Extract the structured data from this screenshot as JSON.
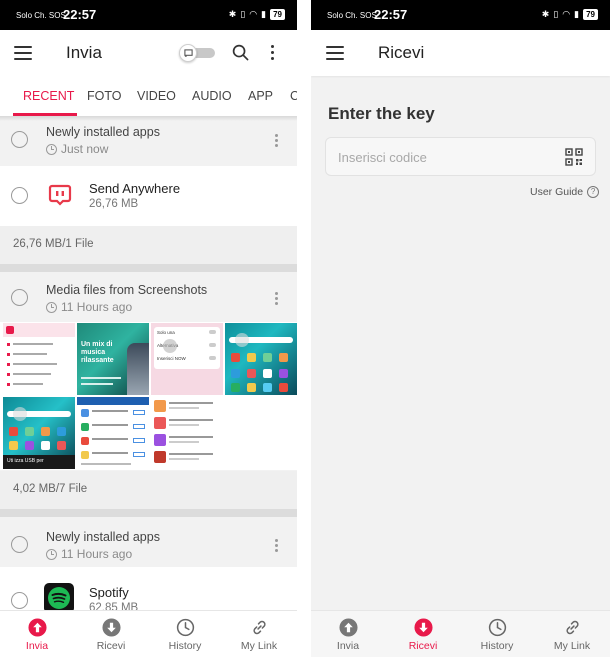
{
  "status_bar": {
    "carrier": "Solo Ch. SOS",
    "time": "22:57",
    "battery": "79"
  },
  "send_screen": {
    "title": "Invia",
    "tabs": [
      {
        "label": "RECENT",
        "active": true
      },
      {
        "label": "FOTO",
        "active": false
      },
      {
        "label": "VIDEO",
        "active": false
      },
      {
        "label": "AUDIO",
        "active": false
      },
      {
        "label": "APP",
        "active": false
      },
      {
        "label": "C",
        "active": false
      }
    ],
    "groups": [
      {
        "title": "Newly installed apps",
        "time": "Just now",
        "items": [
          {
            "name": "Send Anywhere",
            "size": "26,76 MB",
            "icon": "send-anywhere-icon"
          }
        ],
        "summary": "26,76 MB/1 File"
      },
      {
        "title": "Media files from Screenshots",
        "time": "11 Hours ago",
        "summary": "4,02 MB/7 File",
        "thumbnail_texts": {
          "t2_big": "Un mix di musica rilassante",
          "t3_row1": "Solo una",
          "t3_row2": "Alternativa",
          "t3_row3": "Inserisci NOW",
          "t5_label": "Uti izza USB per"
        }
      },
      {
        "title": "Newly installed apps",
        "time": "11 Hours ago",
        "items": [
          {
            "name": "Spotify",
            "size": "62,85 MB",
            "icon": "spotify-icon"
          }
        ]
      }
    ]
  },
  "receive_screen": {
    "title": "Ricevi",
    "heading": "Enter the key",
    "key_placeholder": "Inserisci codice",
    "user_guide": "User Guide"
  },
  "bottom_nav": [
    {
      "label": "Invia",
      "icon": "upload-icon"
    },
    {
      "label": "Ricevi",
      "icon": "download-icon"
    },
    {
      "label": "History",
      "icon": "history-icon"
    },
    {
      "label": "My Link",
      "icon": "link-icon"
    }
  ],
  "colors": {
    "accent": "#e8194a",
    "spotify_green": "#1db954",
    "send_anywhere_red": "#e8394a"
  }
}
